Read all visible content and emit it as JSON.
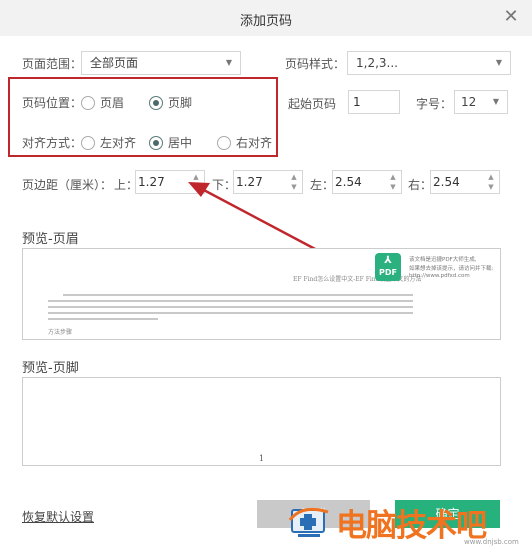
{
  "dialog": {
    "title": "添加页码",
    "close_icon": "close-icon"
  },
  "form": {
    "page_range": {
      "label": "页面范围：",
      "value": "全部页面"
    },
    "number_style": {
      "label": "页码样式：",
      "value": "1,2,3..."
    },
    "position": {
      "label": "页码位置：",
      "options": [
        {
          "label": "页眉",
          "checked": false
        },
        {
          "label": "页脚",
          "checked": true
        }
      ]
    },
    "alignment": {
      "label": "对齐方式：",
      "options": [
        {
          "label": "左对齐",
          "checked": false
        },
        {
          "label": "居中",
          "checked": true
        },
        {
          "label": "右对齐",
          "checked": false
        }
      ]
    },
    "start_page": {
      "label": "起始页码",
      "value": "1"
    },
    "font_size": {
      "label": "字号：",
      "value": "12"
    },
    "margins": {
      "label": "页边距（厘米）：",
      "top": {
        "label": "上：",
        "value": "1.27"
      },
      "bottom": {
        "label": "下：",
        "value": "1.27"
      },
      "left": {
        "label": "左：",
        "value": "2.54"
      },
      "right": {
        "label": "右：",
        "value": "2.54"
      }
    }
  },
  "preview_header": {
    "title": "预览-页眉",
    "doc_title": "EF Find怎么设置中文-EF Find设置中文的方法",
    "doc_subheading": "方法步骤",
    "pdf_badge": "PDF",
    "pdf_note_lines": [
      "该文档是迅捷PDF大师生成,",
      "如果想去掉该提示，请访问并下载:",
      "http://www.pdfxd.com"
    ]
  },
  "preview_footer": {
    "title": "预览-页脚",
    "page_number": "1"
  },
  "footer": {
    "reset_label": "恢复默认设置",
    "cancel_label": "取消",
    "ok_label": "确定"
  },
  "watermark": {
    "text": "电脑技术吧",
    "url": "www.dnjsb.com"
  },
  "colors": {
    "accent": "#27b17d",
    "highlight_box": "#c0272d",
    "annotation_arrow": "#c0272d"
  }
}
